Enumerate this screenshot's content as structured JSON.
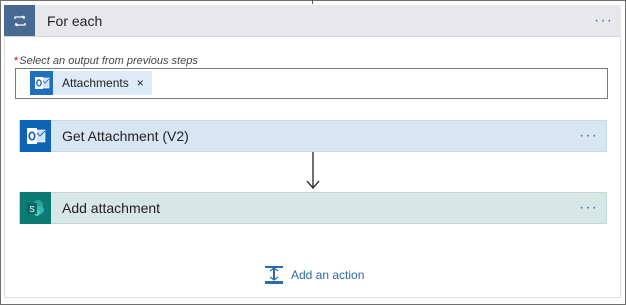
{
  "foreach": {
    "title": "For each",
    "menu_dots": "···"
  },
  "output_field": {
    "required_mark": "*",
    "label": "Select an output from previous steps",
    "token": {
      "label": "Attachments",
      "remove_glyph": "×"
    }
  },
  "actions": [
    {
      "title": "Get Attachment (V2)",
      "menu_dots": "···",
      "icon": "outlook-icon",
      "color": "#0f63b3"
    },
    {
      "title": "Add attachment",
      "menu_dots": "···",
      "icon": "sharepoint-icon",
      "color": "#0a7a72"
    }
  ],
  "add_action": {
    "label": "Add an action",
    "icon": "add-action-icon"
  },
  "colors": {
    "loop_header": "#486991",
    "link": "#2b69b0",
    "dots": "#3a77b8"
  }
}
